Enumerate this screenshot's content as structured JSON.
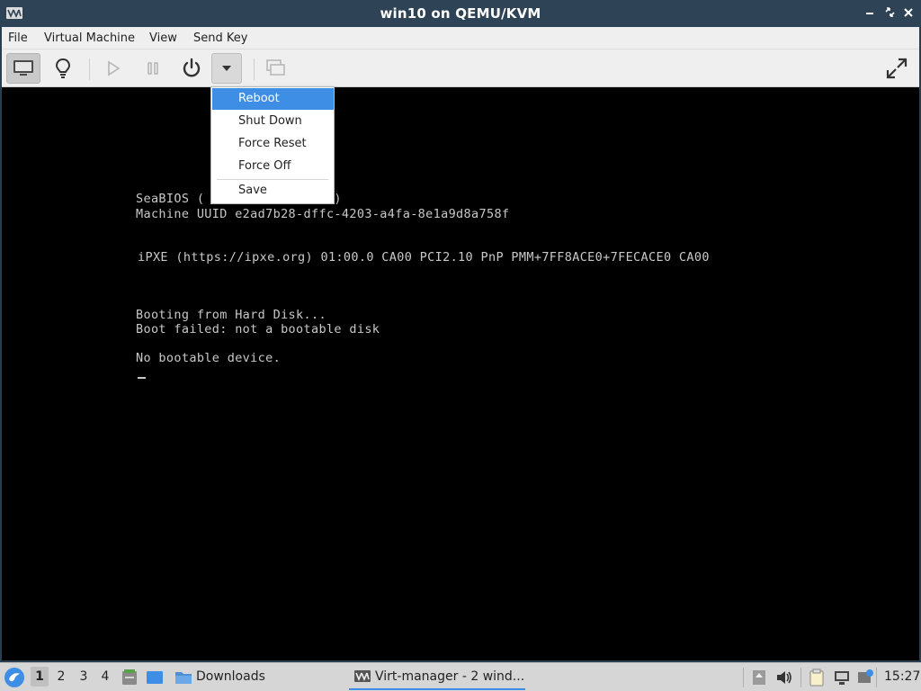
{
  "window": {
    "title": "win10 on QEMU/KVM"
  },
  "menubar": {
    "items": [
      "File",
      "Virtual Machine",
      "View",
      "Send Key"
    ]
  },
  "power_menu": {
    "items": [
      "Reboot",
      "Shut Down",
      "Force Reset",
      "Force Off",
      "Save"
    ],
    "selected": "Reboot"
  },
  "console": {
    "lines": [
      "SeaBIOS (                 )",
      "Machine UUID e2ad7b28-dffc-4203-a4fa-8e1a9d8a758f",
      "iPXE (https://ipxe.org) 01:00.0 CA00 PCI2.10 PnP PMM+7FF8ACE0+7FECACE0 CA00",
      "Booting from Hard Disk...",
      "Boot failed: not a bootable disk",
      "No bootable device."
    ]
  },
  "taskbar": {
    "workspaces": [
      "1",
      "2",
      "3",
      "4"
    ],
    "current_workspace": "1",
    "downloads_label": "Downloads",
    "task_label": "Virt-manager - 2 wind...",
    "clock": "15:27"
  },
  "colors": {
    "titlebar": "#2f4357",
    "accent": "#3d8ee4",
    "console_bg": "#000000",
    "console_text": "#c8c8c8"
  },
  "icons": {
    "toolbar": [
      "monitor-icon",
      "lightbulb-icon",
      "play-icon",
      "pause-icon",
      "power-icon",
      "chevron-down-icon",
      "screenshot-icon",
      "fullscreen-icon"
    ]
  }
}
